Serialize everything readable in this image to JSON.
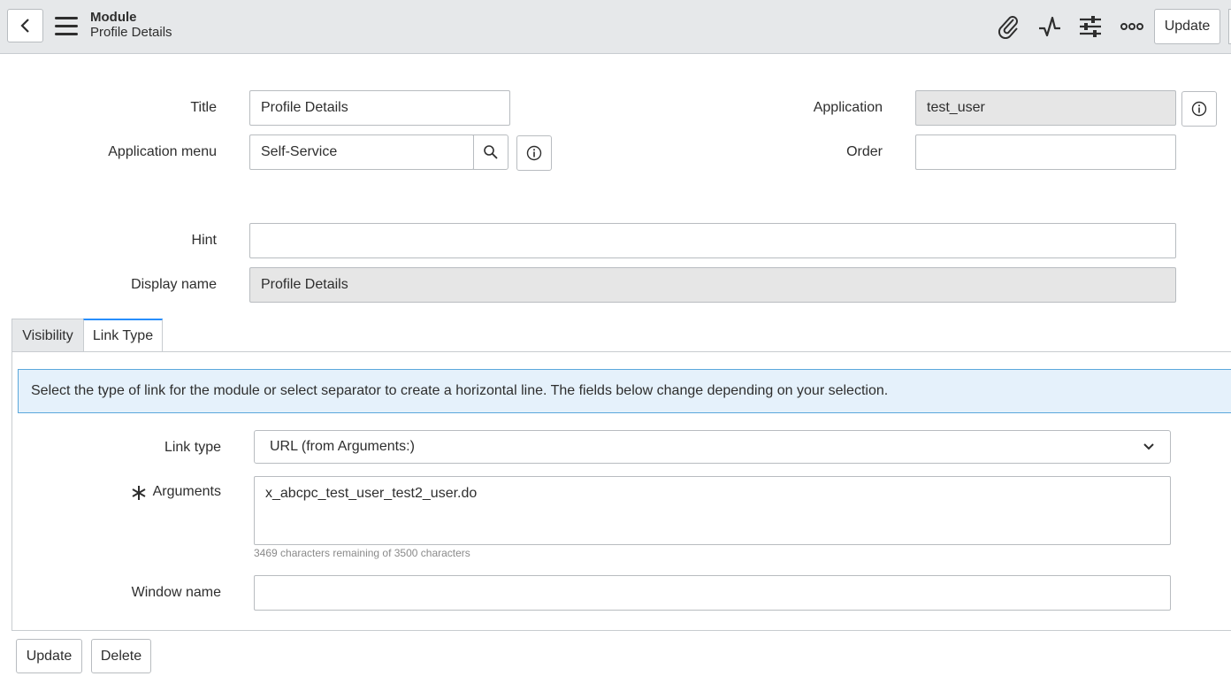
{
  "header": {
    "title": "Module",
    "subtitle": "Profile Details",
    "update_label": "Update",
    "icons": [
      "back-icon",
      "hamburger-icon",
      "paperclip-icon",
      "activity-icon",
      "sliders-icon",
      "more-icon"
    ]
  },
  "form": {
    "title_label": "Title",
    "title_value": "Profile Details",
    "app_menu_label": "Application menu",
    "app_menu_value": "Self-Service",
    "application_label": "Application",
    "application_value": "test_user",
    "order_label": "Order",
    "order_value": "",
    "hint_label": "Hint",
    "hint_value": "",
    "display_name_label": "Display name",
    "display_name_value": "Profile Details"
  },
  "tabs": [
    {
      "label": "Visibility"
    },
    {
      "label": "Link Type"
    }
  ],
  "link_type": {
    "info": "Select the type of link for the module or select separator to create a horizontal line. The fields below change depending on your selection.",
    "link_type_label": "Link type",
    "link_type_value": "URL (from Arguments:)",
    "arguments_label": "Arguments",
    "arguments_value": "x_abcpc_test_user_test2_user.do",
    "counter": "3469 characters remaining of 3500 characters",
    "window_name_label": "Window name",
    "window_name_value": ""
  },
  "footer": {
    "update_label": "Update",
    "delete_label": "Delete"
  }
}
